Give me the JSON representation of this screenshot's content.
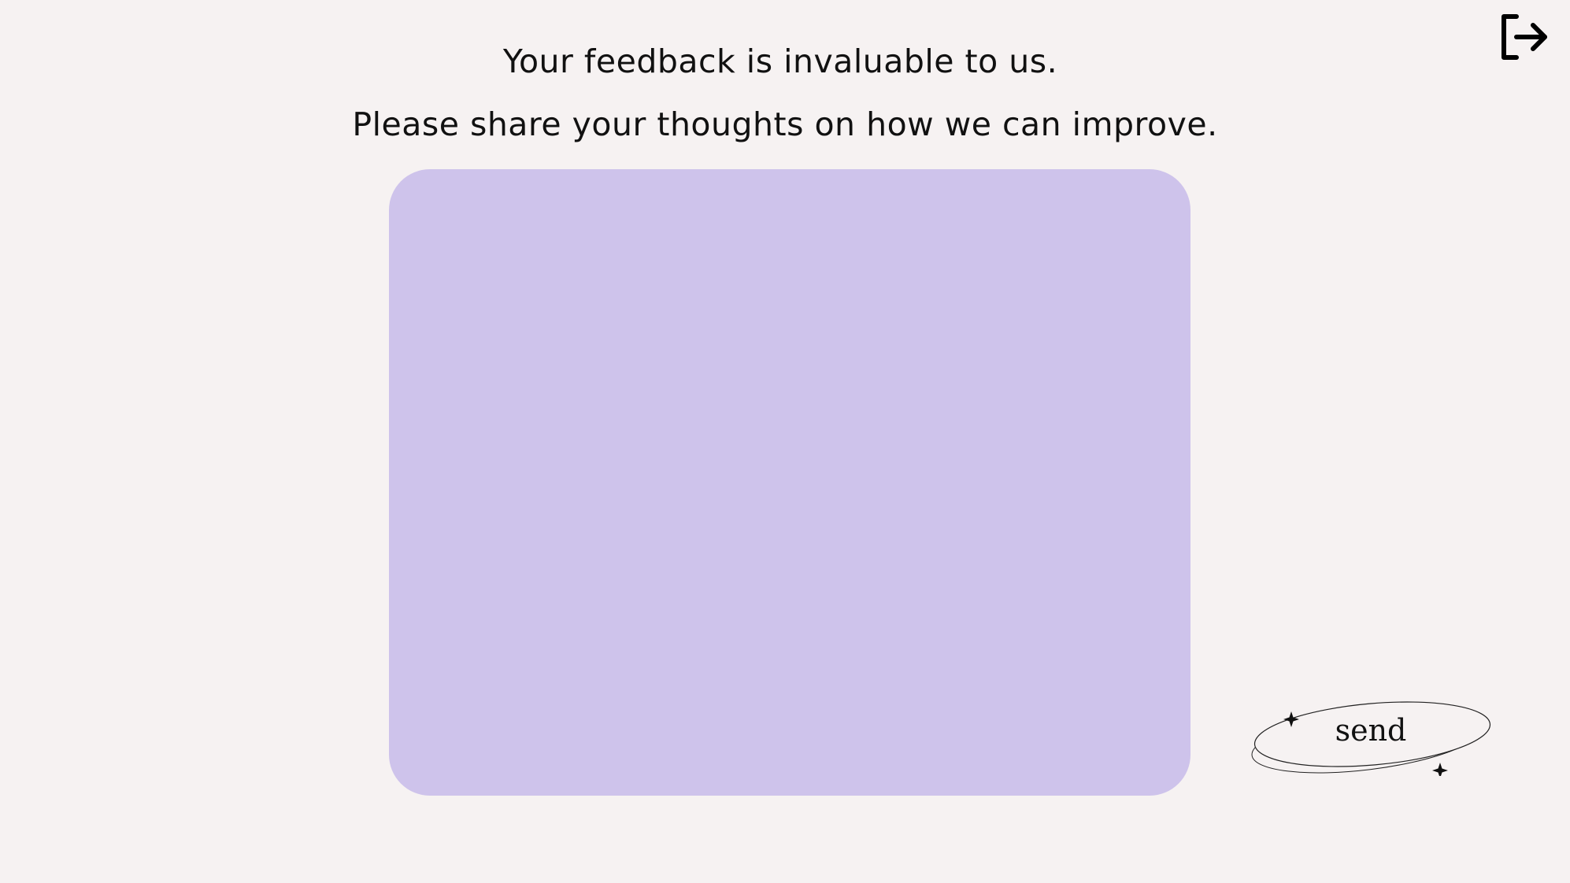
{
  "header": {
    "line1": "Your feedback is invaluable to us.",
    "line2": "Please share your thoughts on how we can improve."
  },
  "feedback": {
    "value": "",
    "placeholder": ""
  },
  "actions": {
    "send_label": "send",
    "exit_icon": "logout-arrow-icon"
  },
  "colors": {
    "background": "#f6f2f2",
    "feedback_box": "#cec3eb",
    "text": "#111111"
  }
}
